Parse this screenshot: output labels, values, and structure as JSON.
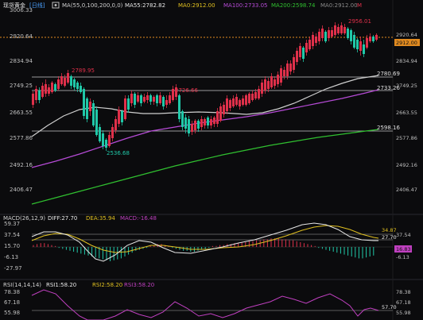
{
  "colors": {
    "bg": "#0b0b0d",
    "up": "#e0304a",
    "down": "#20c8a8",
    "ma5": "#e6e6e6",
    "ma55": "#d8d8d8",
    "ma100": "#b64bd6",
    "ma200": "#30c030",
    "last_price": "#e08a20",
    "text": "#bfbfbf",
    "diff": "#e8e8e8",
    "dea": "#e0c020",
    "macd": "#c040c0",
    "rsi1": "#e8e8e8",
    "rsi2": "#e0c020",
    "rsi3": "#c040c0"
  },
  "header": {
    "symbol": "现货黄金",
    "period": "[日线]",
    "settings_icon": "gear-icon",
    "ma_params": "MA(55,0,100,200,0,0)",
    "ma55": "MA55:2782.82",
    "ma0": "MA0:2912.00",
    "ma100": "MA100:2733.05",
    "ma200": "MA200:2598.74",
    "ma0b": "MA0:2912.00",
    "m_label": "M"
  },
  "price_axis": {
    "ticks": [
      "3006.33",
      "2920.64",
      "2834.94",
      "2749.25",
      "2663.55",
      "2577.86",
      "2492.16",
      "2406.47"
    ],
    "right_labels": [
      "2920.64",
      "2912.00",
      "2834.94",
      "2749.25",
      "2663.55",
      "2577.86",
      "2492.16",
      "2406.47"
    ]
  },
  "annotations": {
    "high_2790": "2789.95",
    "high_2726": "2726.66",
    "low_2536": "2536.68",
    "high_2956": "2956.01",
    "level_2780": "2780.69",
    "level_2733": "2733.26",
    "level_2598": "2598.16"
  },
  "macd": {
    "label": "MACD(26,12,9)",
    "diff": "DIFF:27.70",
    "dea": "DEA:35.94",
    "macd": "MACD:-16.48",
    "ticks": [
      "59.37",
      "37.54",
      "15.70",
      "-6.13",
      "-27.97"
    ],
    "right_labels": [
      "37.54",
      "34.87",
      "27.70",
      "16.83",
      "-6.13"
    ]
  },
  "rsi": {
    "label": "RSI(14,14,14)",
    "rsi1": "RSI1:58.20",
    "rsi2": "RSI2:58.20",
    "rsi3": "RSI3:58.20",
    "ticks": [
      "78.38",
      "67.18",
      "55.98"
    ],
    "right_labels": [
      "78.38",
      "67.18",
      "57.70",
      "55.98"
    ]
  }
}
